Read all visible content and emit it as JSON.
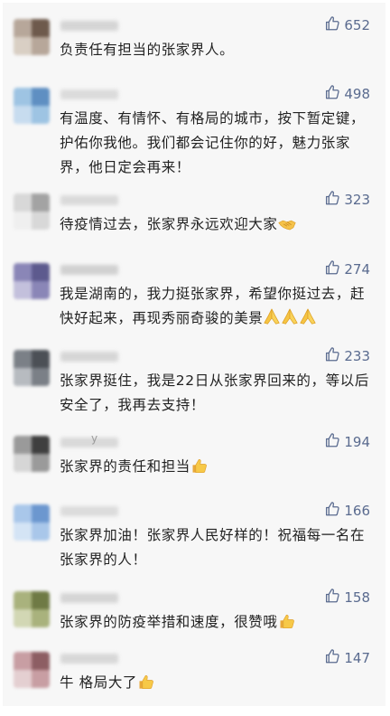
{
  "comments": [
    {
      "likes": "652",
      "text": "负责任有担当的张家界人。",
      "nickname_suffix": "",
      "avatar_colors": [
        "#b7a79a",
        "#6e5a4c",
        "#d9cfc4"
      ],
      "nickname_color": "#c9c9c9",
      "emoji": []
    },
    {
      "likes": "498",
      "text": "有温度、有情怀、有格局的城市，按下暂定键，护佑你我他。我们都会记住你的好，魅力张家界，他日定会再来！",
      "nickname_suffix": "",
      "avatar_colors": [
        "#9ec4e3",
        "#5f8fc2",
        "#c7dcef"
      ],
      "nickname_color": "#d2d2d2",
      "emoji": []
    },
    {
      "likes": "323",
      "text": "待疫情过去，张家界永远欢迎大家",
      "nickname_suffix": "",
      "avatar_colors": [
        "#d8d8d8",
        "#a3a3a3",
        "#efefef"
      ],
      "nickname_color": "#d0d0d0",
      "emoji": [
        "handshake-emoji"
      ]
    },
    {
      "likes": "274",
      "text": "我是湖南的，我力挺张家界，希望你挺过去，赶快好起来，再现秀丽奇骏的美景",
      "nickname_suffix": "",
      "avatar_colors": [
        "#8a86b7",
        "#5d5a8e",
        "#c3c0dc"
      ],
      "nickname_color": "#c4c4c4",
      "emoji": [
        "folded-hands-emoji",
        "folded-hands-emoji",
        "folded-hands-emoji"
      ]
    },
    {
      "likes": "233",
      "text": "张家界挺住，我是22日从张家界回来的，等以后安全了，我再去支持！",
      "nickname_suffix": "",
      "avatar_colors": [
        "#7b8087",
        "#4c5056",
        "#b7bbc0"
      ],
      "nickname_color": "#cbcbcb",
      "emoji": []
    },
    {
      "likes": "194",
      "text": "张家界的责任和担当",
      "nickname_suffix": "y",
      "avatar_colors": [
        "#9a9a9a",
        "#3f3f3f",
        "#d6d6d6"
      ],
      "nickname_color": "#cfcfcf",
      "emoji": [
        "thumbs-up-emoji"
      ]
    },
    {
      "likes": "166",
      "text": "张家界加油！张家界人民好样的！祝福每一名在张家界的人！",
      "nickname_suffix": "",
      "avatar_colors": [
        "#a9c7ea",
        "#6c97cf",
        "#d4e4f5"
      ],
      "nickname_color": "#d3d3d3",
      "emoji": []
    },
    {
      "likes": "158",
      "text": "张家界的防疫举措和速度，很赞哦",
      "nickname_suffix": "",
      "avatar_colors": [
        "#a9b27d",
        "#6f7a45",
        "#d2d7b4"
      ],
      "nickname_color": "#cacaca",
      "emoji": [
        "thumbs-up-emoji"
      ]
    },
    {
      "likes": "147",
      "text": "牛 格局大了",
      "nickname_suffix": "",
      "avatar_colors": [
        "#c89ea3",
        "#8d5e63",
        "#e4cfd1"
      ],
      "nickname_color": "#cdcdcd",
      "emoji": [
        "thumbs-up-emoji"
      ]
    }
  ],
  "colors": {
    "like_blue": "#5a6b8f",
    "text": "#222222",
    "background": "#f7f7f7"
  }
}
